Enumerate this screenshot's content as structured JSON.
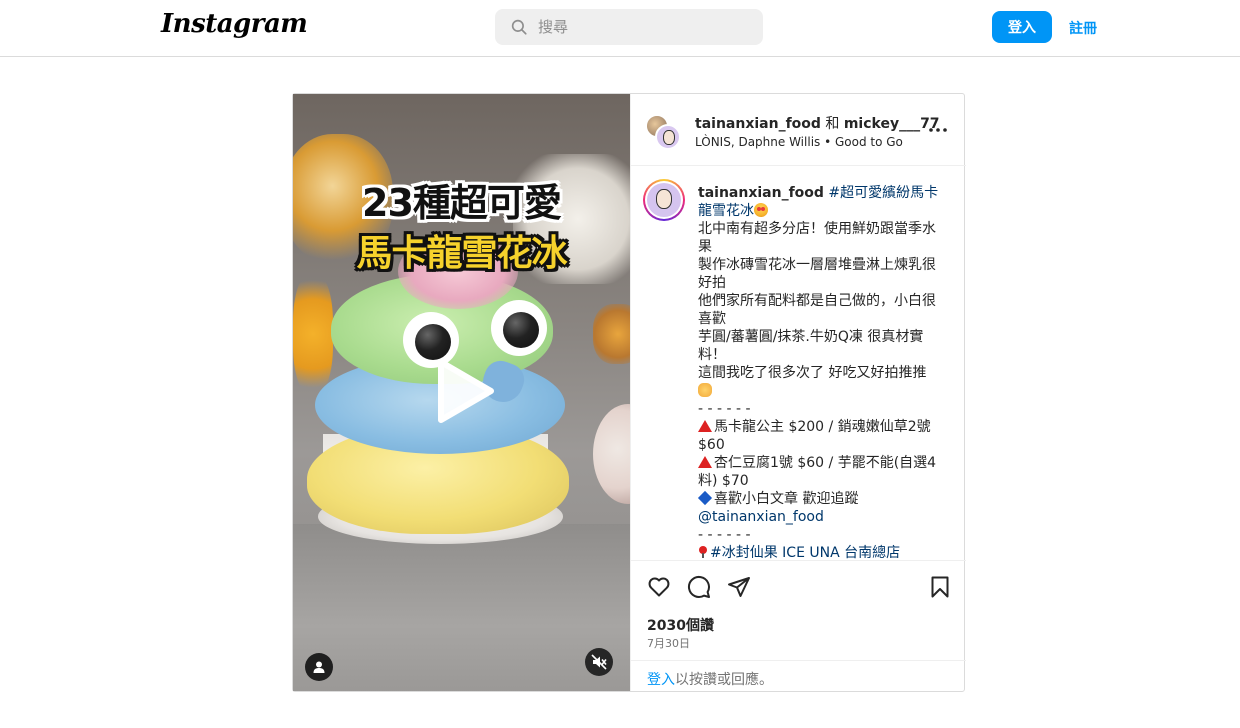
{
  "nav": {
    "logo": "Instagram",
    "search_placeholder": "搜尋",
    "login_label": "登入",
    "signup_label": "註冊"
  },
  "media": {
    "overlay_line1": "23種超可愛",
    "overlay_line2": "馬卡龍雪花冰",
    "icons": [
      "play-icon",
      "user-tag-icon",
      "muted-speaker-icon"
    ]
  },
  "post": {
    "header": {
      "user1": "tainanxian_food",
      "and": " 和 ",
      "user2": "mickey___77",
      "audio": "LÒNIS, Daphne Willis • Good to Go"
    },
    "caption": {
      "username": "tainanxian_food",
      "hashtag": "#超可愛繽紛馬卡龍雪花冰",
      "lines": [
        "北中南有超多分店！使用鮮奶跟當季水果",
        "製作冰磚雪花冰一層層堆疊淋上煉乳很好拍",
        "他們家所有配料都是自己做的，小白很喜歡",
        "芋圓/蕃薯圓/抹茶.牛奶Q凍 很真材實料！",
        "這間我吃了很多次了 好吃又好拍推推",
        "- - - - - -",
        "馬卡龍公主 $200 / 銷魂嫩仙草2號 $60",
        "杏仁豆腐1號 $60 / 芋罷不能(自選4料) $70",
        "喜歡小白文章 歡迎追蹤",
        "@tainanxian_food",
        "- - - - - -",
        "#冰封仙果 ICE UNA 台南總店"
      ]
    },
    "views": "2030個讚",
    "date": "7月30日",
    "footer_login": "登入",
    "footer_rest": "以按讚或回應。"
  },
  "colors": {
    "accent": "#0095f6",
    "text": "#262626",
    "muted": "#737373",
    "border": "#dbdbdb",
    "hashtag": "#00376b"
  }
}
